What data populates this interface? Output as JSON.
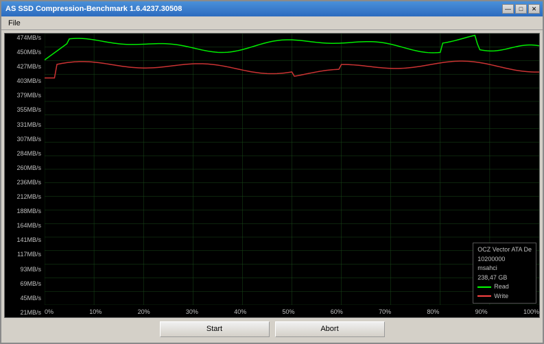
{
  "window": {
    "title": "AS SSD Compression-Benchmark 1.6.4237.30508",
    "min_btn": "—",
    "max_btn": "□",
    "close_btn": "✕"
  },
  "menu": {
    "file_label": "File"
  },
  "chart": {
    "y_labels": [
      "474MB/s",
      "450MB/s",
      "427MB/s",
      "403MB/s",
      "379MB/s",
      "355MB/s",
      "331MB/s",
      "307MB/s",
      "284MB/s",
      "260MB/s",
      "236MB/s",
      "212MB/s",
      "188MB/s",
      "164MB/s",
      "141MB/s",
      "117MB/s",
      "93MB/s",
      "69MB/s",
      "45MB/s",
      "21MB/s"
    ],
    "x_labels": [
      "0%",
      "10%",
      "20%",
      "30%",
      "40%",
      "50%",
      "60%",
      "70%",
      "80%",
      "90%",
      "100%"
    ],
    "grid_color": "#1a3a1a",
    "legend": {
      "device": "OCZ Vector ATA De",
      "number": "10200000",
      "driver": "msahci",
      "size": "238,47 GB",
      "read_label": "Read",
      "write_label": "Write",
      "read_color": "#00ff00",
      "write_color": "#ff4444"
    }
  },
  "buttons": {
    "start_label": "Start",
    "abort_label": "Abort"
  }
}
